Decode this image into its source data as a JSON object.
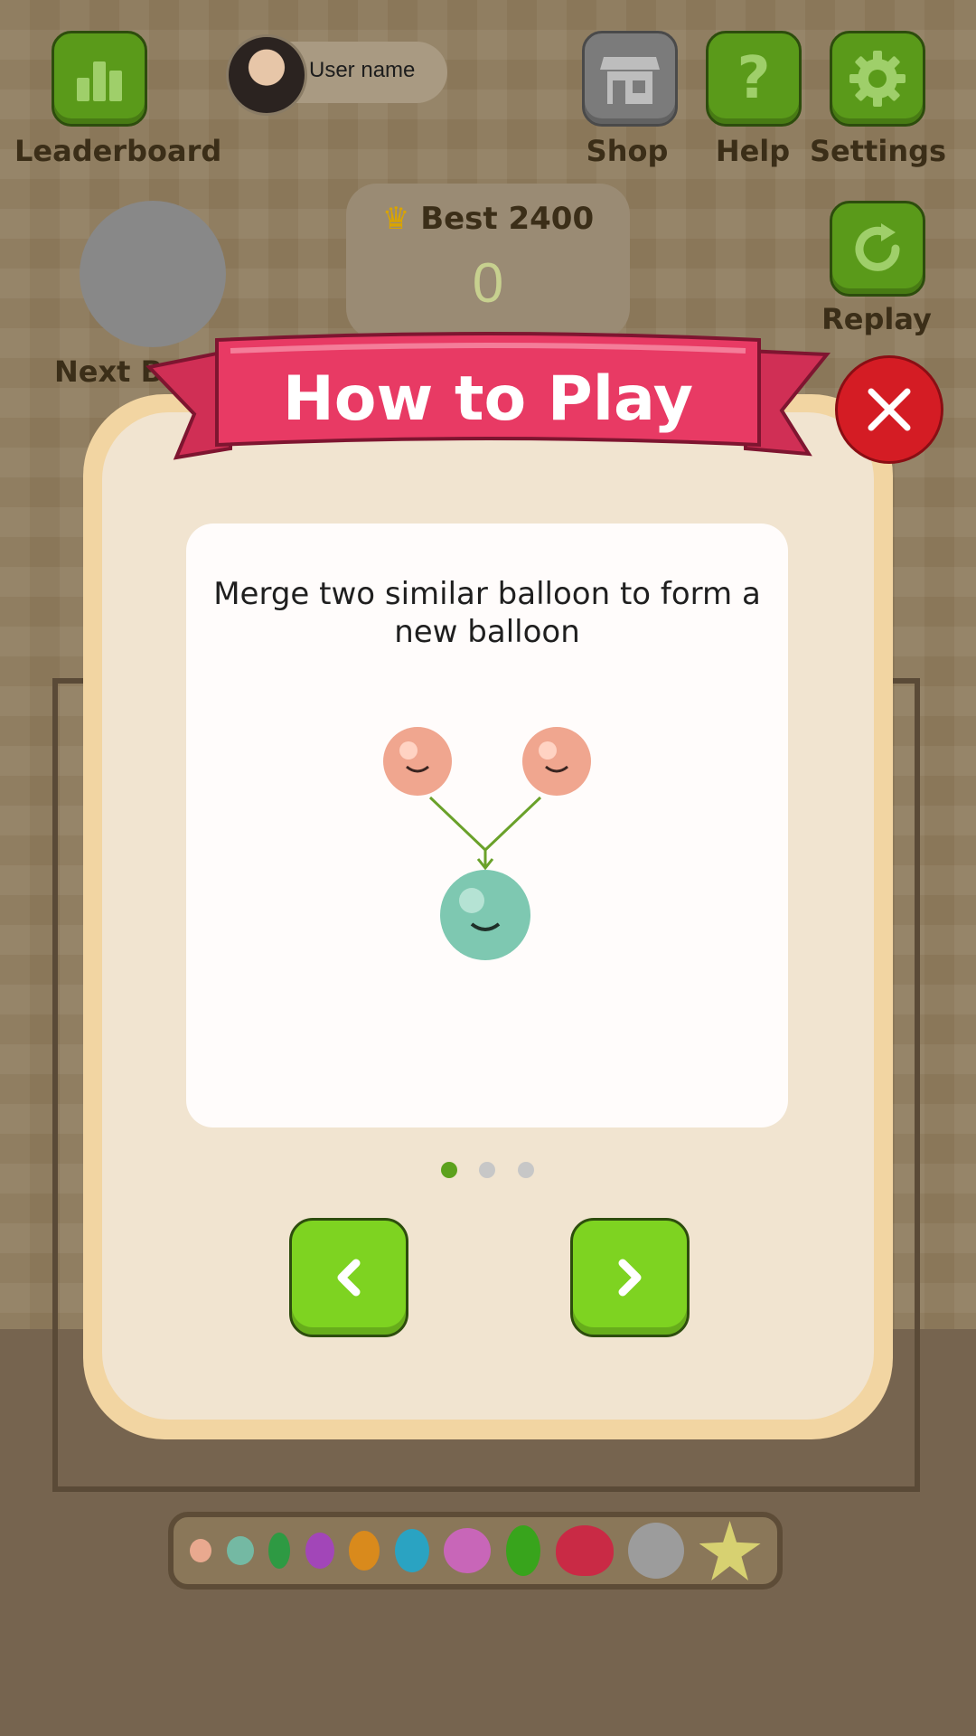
{
  "top_bar": {
    "leaderboard_label": "Leaderboard",
    "username": "User name",
    "shop_label": "Shop",
    "help_label": "Help",
    "settings_label": "Settings",
    "replay_label": "Replay"
  },
  "score": {
    "best_label": "Best 2400",
    "current": "0"
  },
  "next_ball_label": "Next Ba",
  "modal": {
    "title": "How to Play",
    "instruction": "Merge two similar balloon to form a new balloon",
    "page_dots": [
      true,
      false,
      false
    ],
    "prev_icon": "chevron-left-icon",
    "next_icon": "chevron-right-icon",
    "close_icon": "close-icon"
  },
  "tray": {
    "balloons": [
      "peach",
      "teal",
      "green",
      "purple",
      "orange",
      "blue",
      "bear-pink",
      "green-tall",
      "heart-red",
      "gray",
      "star-yellow"
    ]
  },
  "colors": {
    "green_button": "#5a9a1a",
    "nav_button": "#7ed321",
    "banner": "#e83a64",
    "close": "#d41c24",
    "active_dot": "#5ca11d"
  }
}
